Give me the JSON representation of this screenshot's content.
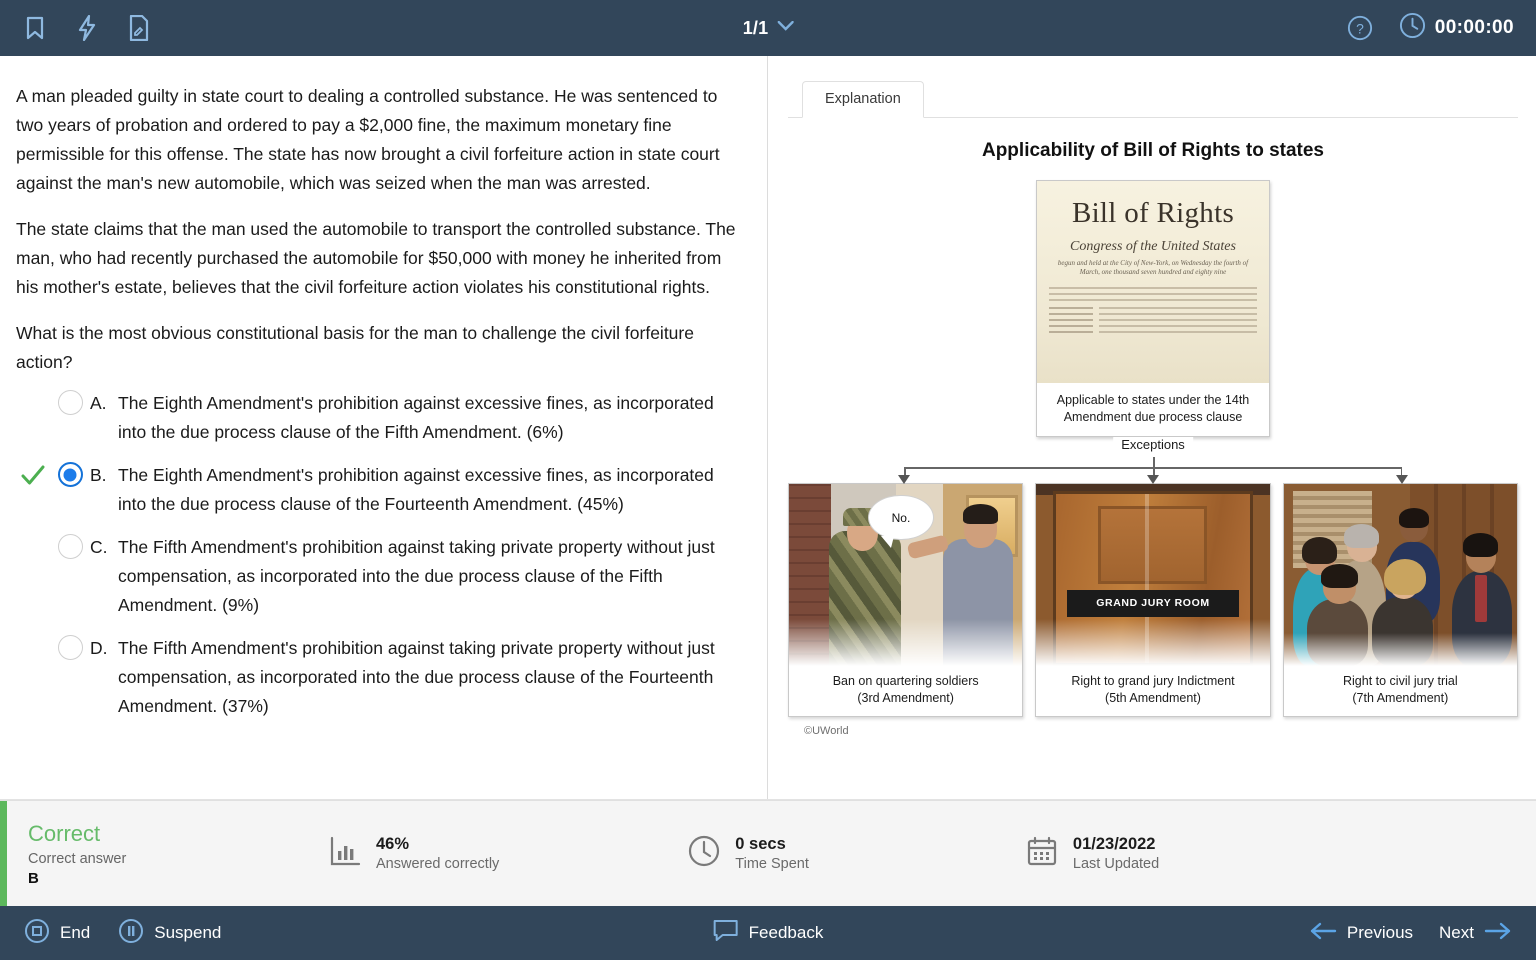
{
  "topbar": {
    "icons": [
      {
        "name": "bookmark-icon",
        "label": "Bookmark"
      },
      {
        "name": "flag-icon",
        "label": "Lab Values"
      },
      {
        "name": "notes-icon",
        "label": "Notes"
      }
    ],
    "page_indicator": "1/1",
    "help_label": "?",
    "timer": "00:00:00",
    "bg_color": "#32465a",
    "icon_color": "#7fb0dd"
  },
  "question": {
    "paragraphs": [
      "A man pleaded guilty in state court to dealing a controlled substance.  He was sentenced to two years of probation and ordered to pay a $2,000 fine, the maximum monetary fine permissible for this offense.  The state has now brought a civil forfeiture action in state court against the man's new automobile, which was seized when the man was arrested.",
      "The state claims that the man used the automobile to transport the controlled substance.  The man, who had recently purchased the automobile for $50,000 with money he inherited from his mother's estate, believes that the civil forfeiture action violates his constitutional rights."
    ],
    "stem": "What is the most obvious constitutional basis for the man to challenge the civil forfeiture action?",
    "choices": [
      {
        "letter": "A.",
        "text": "The Eighth Amendment's prohibition against excessive fines, as incorporated into the due process clause of the Fifth Amendment. (6%)",
        "selected": false,
        "correct": false
      },
      {
        "letter": "B.",
        "text": "The Eighth Amendment's prohibition against excessive fines, as incorporated into the due process clause of the Fourteenth Amendment. (45%)",
        "selected": true,
        "correct": true
      },
      {
        "letter": "C.",
        "text": "The Fifth Amendment's prohibition against taking private property without just compensation, as incorporated into the due process clause of the Fifth Amendment. (9%)",
        "selected": false,
        "correct": false
      },
      {
        "letter": "D.",
        "text": "The Fifth Amendment's prohibition against taking private property without just compensation, as incorporated into the due process clause of the Fourteenth Amendment. (37%)",
        "selected": false,
        "correct": false
      }
    ]
  },
  "explanation": {
    "tab_label": "Explanation",
    "diagram_title": "Applicability of Bill of Rights to states",
    "bill_of_rights": {
      "heading": "Bill of Rights",
      "subheading": "Congress of the United States",
      "fineprint": "begun and held at the City of New-York, on Wednesday the fourth of March, one thousand seven hundred and eighty nine",
      "caption": "Applicable to states under the 14th Amendment due process clause"
    },
    "exceptions_label": "Exceptions",
    "exception_cards": [
      {
        "caption_line1": "Ban on quartering soldiers",
        "caption_line2": "(3rd Amendment)",
        "image_text": "No.",
        "art": "soldier-at-door"
      },
      {
        "caption_line1": "Right to grand jury Indictment",
        "caption_line2": "(5th Amendment)",
        "image_text": "GRAND JURY ROOM",
        "art": "grand-jury-door"
      },
      {
        "caption_line1": "Right to civil jury trial",
        "caption_line2": "(7th Amendment)",
        "image_text": "",
        "art": "jury-box"
      }
    ],
    "copyright": "©UWorld"
  },
  "status": {
    "result": "Correct",
    "result_color": "#66bb6a",
    "correct_answer_label": "Correct answer",
    "correct_answer": "B",
    "metrics": [
      {
        "icon": "bar-chart-icon",
        "value": "46%",
        "label": "Answered correctly"
      },
      {
        "icon": "clock-icon",
        "value": "0 secs",
        "label": "Time Spent"
      },
      {
        "icon": "calendar-icon",
        "value": "01/23/2022",
        "label": "Last Updated"
      }
    ]
  },
  "bottombar": {
    "end_label": "End",
    "suspend_label": "Suspend",
    "feedback_label": "Feedback",
    "previous_label": "Previous",
    "next_label": "Next"
  }
}
